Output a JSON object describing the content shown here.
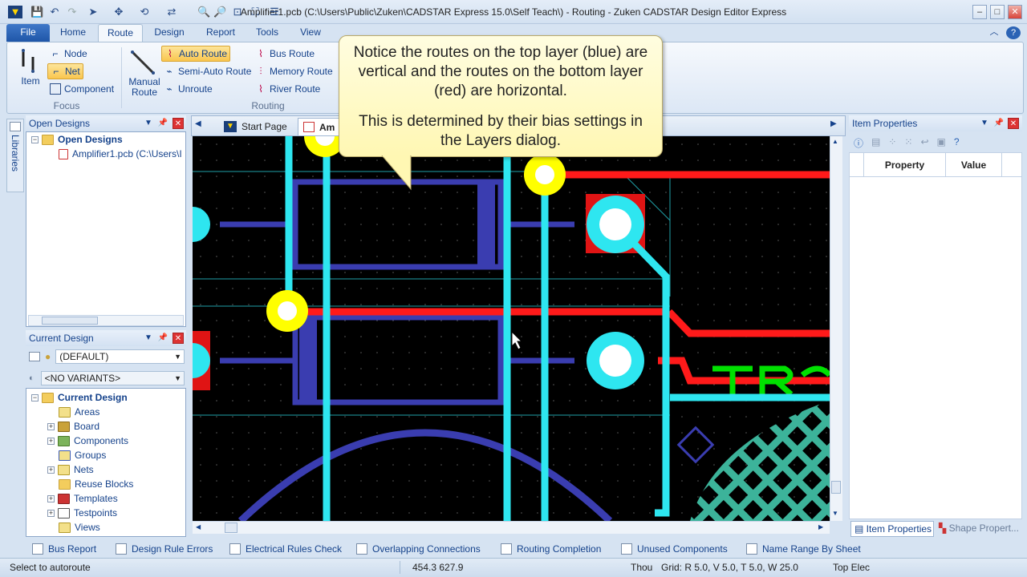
{
  "window": {
    "title": "Amplifier1.pcb (C:\\Users\\Public\\Zuken\\CADSTAR Express 15.0\\Self Teach\\) - Routing - Zuken CADSTAR Design Editor Express"
  },
  "ribbon": {
    "tabs": [
      "File",
      "Home",
      "Route",
      "Design",
      "Report",
      "Tools",
      "View"
    ],
    "focus": {
      "group_label": "Focus",
      "item_label": "Item",
      "node_label": "Node",
      "net_label": "Net",
      "component_label": "Component"
    },
    "routing": {
      "group_label": "Routing",
      "manual_route_label": "Manual\nRoute",
      "auto_route_label": "Auto Route",
      "semi_auto_route_label": "Semi-Auto Route",
      "unroute_label": "Unroute",
      "bus_route_label": "Bus Route",
      "memory_route_label": "Memory Route",
      "river_route_label": "River Route"
    }
  },
  "callout": {
    "line1": "Notice the routes on the top layer (blue) are vertical and the routes on the bottom layer (red) are horizontal.",
    "line2": "This is determined by their bias settings in the Layers dialog."
  },
  "side_tab": "Libraries",
  "open_designs": {
    "title": "Open Designs",
    "root_label": "Open Designs",
    "file_label": "Amplifier1.pcb (C:\\Users\\I"
  },
  "current_design": {
    "title": "Current Design",
    "dropdown_value": "(DEFAULT)",
    "variants_value": "<NO VARIANTS>",
    "root_label": "Current Design",
    "items": [
      "Areas",
      "Board",
      "Components",
      "Groups",
      "Nets",
      "Reuse Blocks",
      "Templates",
      "Testpoints",
      "Views"
    ]
  },
  "doc_tabs": {
    "start_page": "Start Page",
    "active": "Am"
  },
  "item_properties": {
    "title": "Item Properties",
    "col_property": "Property",
    "col_value": "Value",
    "tab_item_properties": "Item Properties",
    "tab_shape_properties": "Shape Propert..."
  },
  "bottom_tabs": [
    "Bus Report",
    "Design Rule Errors",
    "Electrical Rules Check",
    "Overlapping Connections",
    "Routing Completion",
    "Unused Components",
    "Name Range By Sheet"
  ],
  "status": {
    "message": "Select to autoroute",
    "coords": "454.3  627.9",
    "units": "Thou",
    "grid": "Grid:  R 5.0, V 5.0, T 5.0, W 25.0",
    "layer": "Top Elec"
  },
  "colors": {
    "top_layer_route": "#2ee6f0",
    "bottom_layer_route": "#ff1a1a",
    "component_outline": "#3a3db0",
    "pad_yellow": "#ffff00",
    "silkscreen_green": "#00e000",
    "copper_area": "#3cb39a"
  }
}
